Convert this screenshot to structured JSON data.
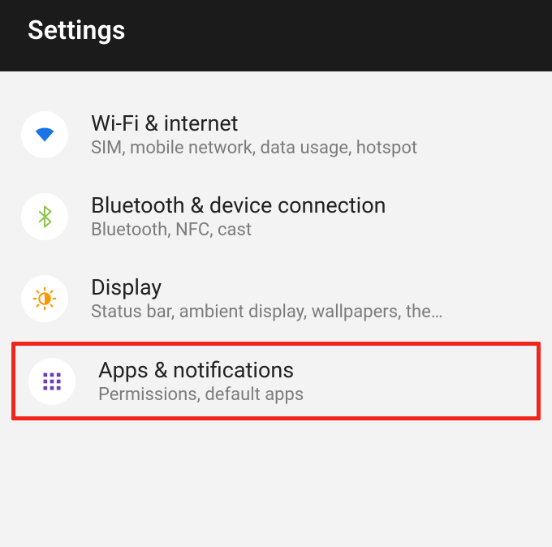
{
  "header": {
    "title": "Settings"
  },
  "rows": [
    {
      "id": "wifi-internet",
      "icon": "wifi-icon",
      "title": "Wi-Fi & internet",
      "subtitle": "SIM, mobile network, data usage, hotspot",
      "highlight": false
    },
    {
      "id": "bluetooth-device",
      "icon": "bluetooth-icon",
      "title": "Bluetooth & device connection",
      "subtitle": "Bluetooth, NFC, cast",
      "highlight": false
    },
    {
      "id": "display",
      "icon": "brightness-icon",
      "title": "Display",
      "subtitle": "Status bar, ambient display, wallpapers, the…",
      "highlight": false
    },
    {
      "id": "apps-notifications",
      "icon": "apps-grid-icon",
      "title": "Apps & notifications",
      "subtitle": "Permissions, default apps",
      "highlight": true
    }
  ],
  "colors": {
    "wifi": "#1a73e8",
    "bluetooth": "#8bc34a",
    "brightness": "#ff9800",
    "apps": "#6a3fb5",
    "highlight": "#f0251c"
  }
}
